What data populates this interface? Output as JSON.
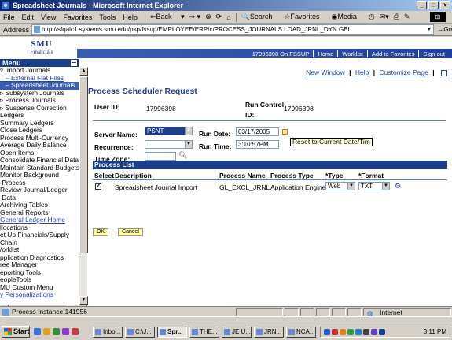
{
  "window": {
    "title": "Spreadsheet Journals - Microsoft Internet Explorer"
  },
  "menu": {
    "items": [
      "File",
      "Edit",
      "View",
      "Favorites",
      "Tools",
      "Help"
    ],
    "back": "Back",
    "search": "Search",
    "favorites": "Favorites",
    "media": "Media"
  },
  "address": {
    "label": "Address",
    "url": "http://sfqalc1.systems.smu.edu/psp/fssup/EMPLOYEE/ERP/c/PROCESS_JOURNALS.LOAD_JRNL_DYN.GBL",
    "go": "Go"
  },
  "portal": {
    "logo_main": "SMU",
    "logo_sub": "Financials",
    "header_links": [
      "17996398 On FSSUP",
      "Home",
      "Worklist",
      "Add to Favorites",
      "Sign out"
    ]
  },
  "nav": {
    "title": "Menu",
    "items": [
      {
        "text": "▿ Import Journals",
        "cls": ""
      },
      {
        "text": "   – External Flat Files",
        "cls": "link"
      },
      {
        "text": "   – Spreadsheet Journals",
        "cls": "sel"
      },
      {
        "text": "▹ Subsystem Journals",
        "cls": ""
      },
      {
        "text": "▹ Process Journals",
        "cls": ""
      },
      {
        "text": "▹ Suspense Correction",
        "cls": ""
      },
      {
        "text": "Ledgers",
        "cls": ""
      },
      {
        "text": "Summary Ledgers",
        "cls": ""
      },
      {
        "text": "Close Ledgers",
        "cls": ""
      },
      {
        "text": "Process Multi-Currency",
        "cls": ""
      },
      {
        "text": "Average Daily Balance",
        "cls": ""
      },
      {
        "text": "Open Items",
        "cls": ""
      },
      {
        "text": "Consolidate Financial Data",
        "cls": ""
      },
      {
        "text": "Maintain Standard Budgets",
        "cls": ""
      },
      {
        "text": "Monitor Background",
        "cls": ""
      },
      {
        "text": " Process",
        "cls": ""
      },
      {
        "text": "Review Journal/Ledger",
        "cls": ""
      },
      {
        "text": " Data",
        "cls": ""
      },
      {
        "text": "Archiving Tables",
        "cls": ""
      },
      {
        "text": "General Reports",
        "cls": ""
      },
      {
        "text": "General Ledger Home",
        "cls": "link"
      },
      {
        "text": "llocations",
        "cls": ""
      },
      {
        "text": "et Up Financials/Supply",
        "cls": ""
      },
      {
        "text": "Chain",
        "cls": ""
      },
      {
        "text": "/orklist",
        "cls": ""
      },
      {
        "text": "pplication Diagnostics",
        "cls": ""
      },
      {
        "text": "ree Manager",
        "cls": ""
      },
      {
        "text": "eporting Tools",
        "cls": ""
      },
      {
        "text": "eopleTools",
        "cls": ""
      },
      {
        "text": "MU Custom Menu",
        "cls": ""
      },
      {
        "text": "y Personalizations",
        "cls": "link"
      }
    ]
  },
  "toplinks": {
    "new_window": "New Window",
    "help": "Help",
    "customize": "Customize Page"
  },
  "form": {
    "title": "Process Scheduler Request",
    "user_id_label": "User ID:",
    "user_id": "17996398",
    "run_control_label": "Run Control",
    "run_control_label2": "ID:",
    "run_control": "17996398",
    "server_name_label": "Server Name:",
    "server_name": "PSNT",
    "run_date_label": "Run Date:",
    "run_date": "03/17/2005",
    "recurrence_label": "Recurrence:",
    "recurrence": "",
    "run_time_label": "Run Time:",
    "run_time": "3:10:57PM",
    "reset_btn": "Reset to Current Date/Tim",
    "time_zone_label": "Time Zone:",
    "time_zone": ""
  },
  "process_list": {
    "title": "Process List",
    "headers": {
      "select": "Select",
      "description": "Description",
      "process_name": "Process Name",
      "process_type": "Process Type",
      "type": "*Type",
      "format": "*Format"
    },
    "rows": [
      {
        "checked": "✔",
        "description": "Spreadsheet Journal Import",
        "process_name": "GL_EXCL_JRNL",
        "process_type": "Application Engine",
        "type": "Web",
        "format": "TXT"
      }
    ]
  },
  "buttons": {
    "ok": "OK",
    "cancel": "Cancel"
  },
  "status": {
    "text": "Process Instance:141956",
    "zone": "Internet"
  },
  "taskbar": {
    "start": "Start",
    "tasks": [
      "Inbo...",
      "C:\\J...",
      "Spr...",
      "THE...",
      "JE U...",
      "JRN...",
      "NCA..."
    ],
    "clock": "3:11 PM"
  }
}
